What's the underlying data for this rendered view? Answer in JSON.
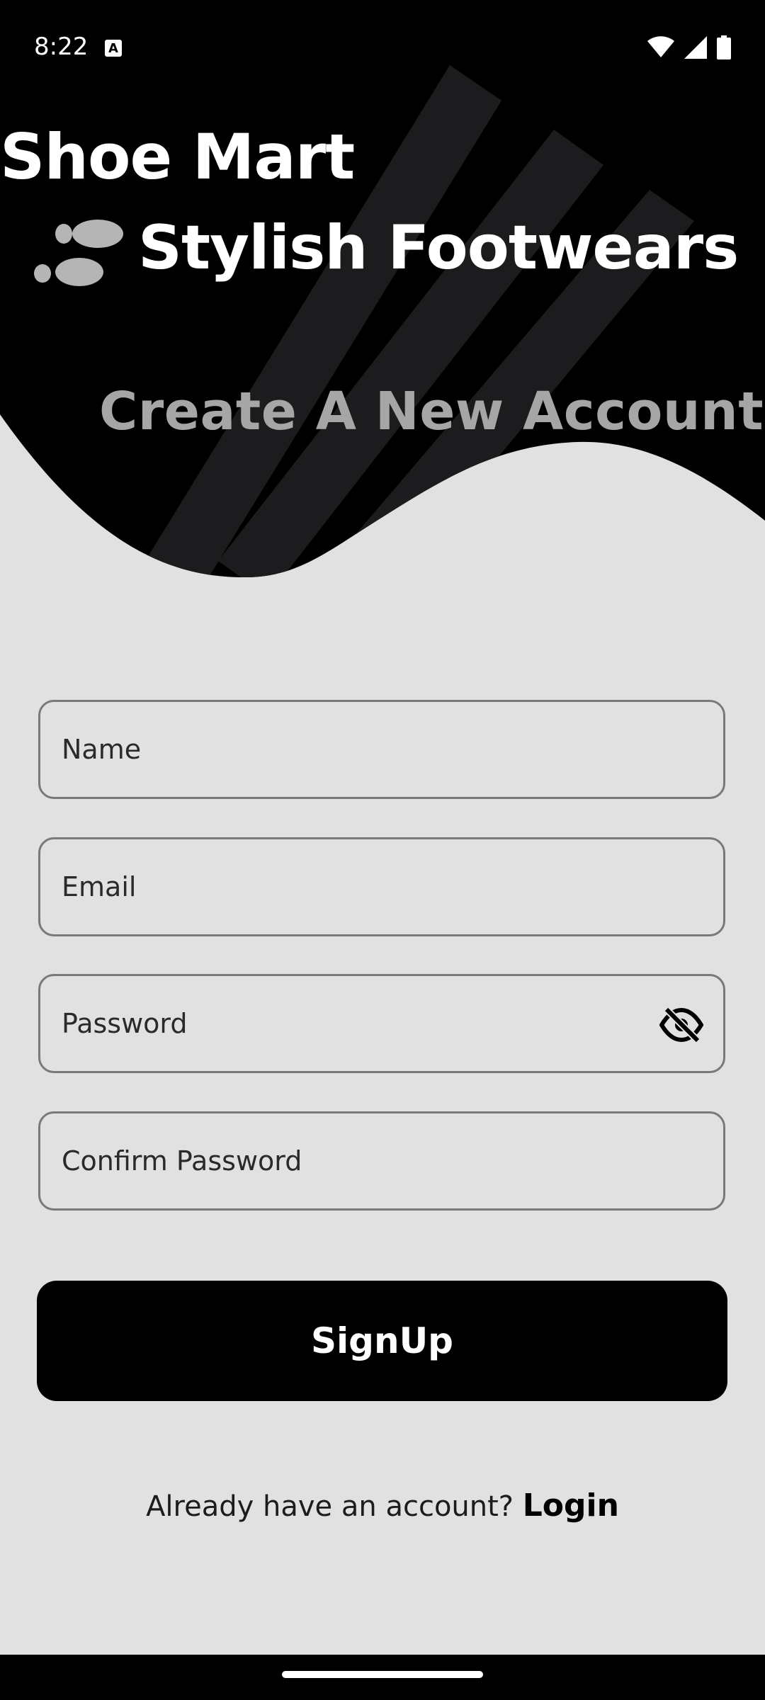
{
  "status_bar": {
    "time": "8:22",
    "notification_icon": "a-badge-icon",
    "icons": [
      "wifi-icon",
      "signal-icon",
      "battery-icon"
    ]
  },
  "header": {
    "app_title": "Shoe Mart",
    "logo_icon": "footprints-icon",
    "tagline": "Stylish Footwears"
  },
  "screen_heading": "Create A New Account",
  "form": {
    "name_placeholder": "Name",
    "email_placeholder": "Email",
    "password_placeholder": "Password",
    "password_toggle_icon": "eye-off-icon",
    "confirm_password_placeholder": "Confirm Password",
    "submit_label": "SignUp"
  },
  "footer": {
    "prompt": "Already have an account?",
    "login_label": "Login"
  },
  "colors": {
    "header_bg": "#000000",
    "page_bg": "#e1e1e1",
    "stripe": "#1c1c1e",
    "heading": "#a6a6a6",
    "button_bg": "#000000",
    "field_border": "#797979"
  }
}
